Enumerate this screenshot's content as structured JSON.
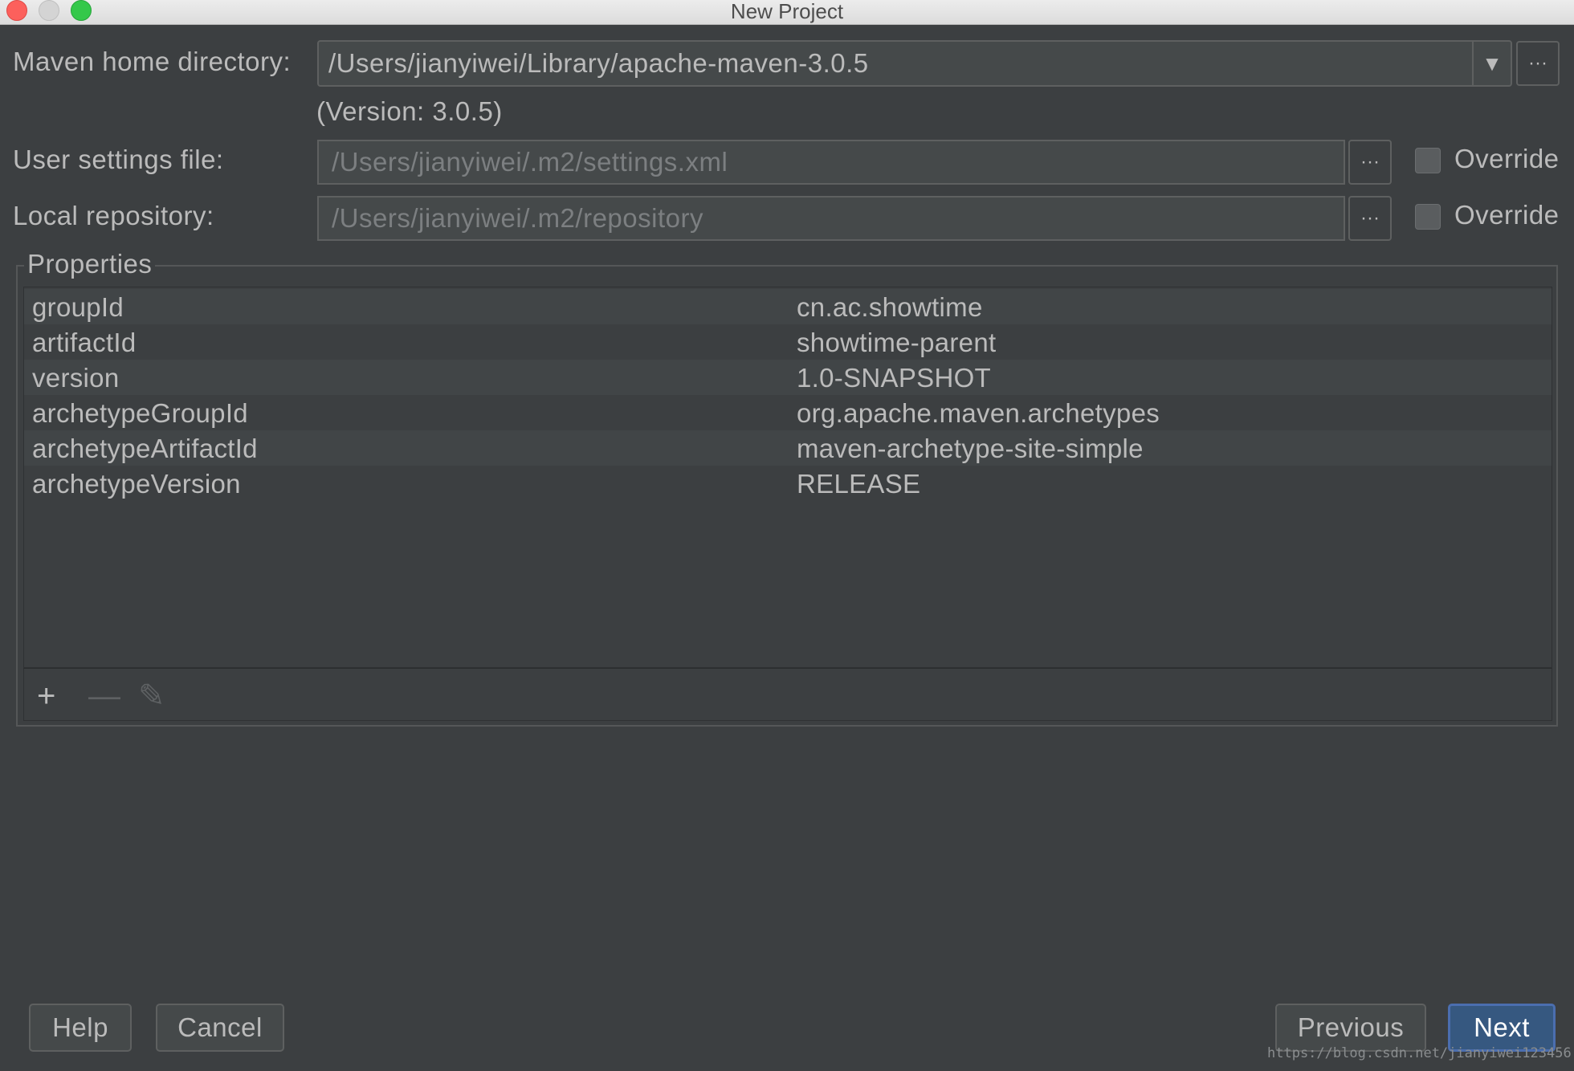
{
  "window": {
    "title": "New Project"
  },
  "form": {
    "maven_home_label": "Maven home directory:",
    "maven_home_value": "/Users/jianyiwei/Library/apache-maven-3.0.5",
    "version_note": "(Version: 3.0.5)",
    "user_settings_label": "User settings file:",
    "user_settings_value": "/Users/jianyiwei/.m2/settings.xml",
    "local_repo_label": "Local repository:",
    "local_repo_value": "/Users/jianyiwei/.m2/repository",
    "override_label": "Override",
    "browse_label": "···",
    "dropdown_arrow": "▼"
  },
  "properties": {
    "title": "Properties",
    "rows": [
      {
        "key": "groupId",
        "value": "cn.ac.showtime"
      },
      {
        "key": "artifactId",
        "value": "showtime-parent"
      },
      {
        "key": "version",
        "value": "1.0-SNAPSHOT"
      },
      {
        "key": "archetypeGroupId",
        "value": "org.apache.maven.archetypes"
      },
      {
        "key": "archetypeArtifactId",
        "value": "maven-archetype-site-simple"
      },
      {
        "key": "archetypeVersion",
        "value": "RELEASE"
      }
    ],
    "toolbar": {
      "add": "+",
      "remove": "—",
      "edit": "✎"
    }
  },
  "buttons": {
    "help": "Help",
    "cancel": "Cancel",
    "previous": "Previous",
    "next": "Next"
  },
  "watermark": "https://blog.csdn.net/jianyiwei123456",
  "colors": {
    "background": "#3c3f41",
    "field": "#45494a",
    "primary_button": "#365880",
    "text": "#bbbbbb"
  }
}
